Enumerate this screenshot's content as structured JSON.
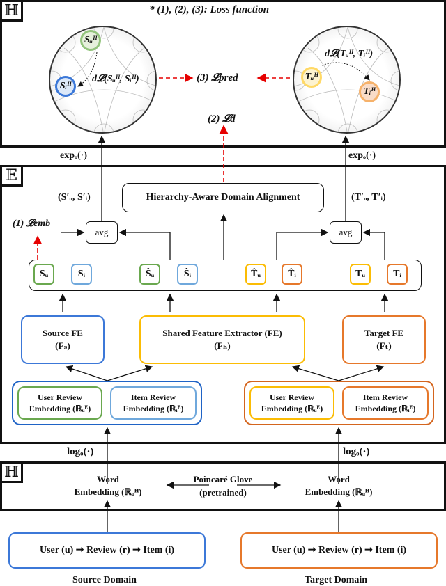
{
  "colors": {
    "green": "#6aa84f",
    "blue": "#3c78d8",
    "yellow": "#f1c232",
    "orange": "#e69138",
    "red_dashed": "#e60000",
    "green_fill": "#e6f0dc",
    "blue_fill": "#dce8f8",
    "yellow_fill": "#fdf3d0",
    "orange_fill": "#f9dcc8"
  },
  "top_panel": {
    "space_tag": "ℍ",
    "legend_note": "* (1), (2), (3): Loss function",
    "left_disk": {
      "node_u": "Sᵤᴴ",
      "node_i": "Sᵢᴴ",
      "distance": "d𝓛(Sᵤᴴ, Sᵢᴴ)"
    },
    "right_disk": {
      "node_u": "Tᵤᴴ",
      "node_i": "Tᵢᴴ",
      "distance": "d𝓛(Tᵤᴴ, Tᵢᴴ)"
    },
    "pred_loss": "(3) 𝓛pred",
    "domain_loss": "(2) 𝓛d"
  },
  "transitions": {
    "exp_left": "expₒ(·)",
    "exp_right": "expₒ(·)",
    "log_left": "logₒ(·)",
    "log_right": "logₒ(·)"
  },
  "middle_panel": {
    "space_tag": "𝔼",
    "alignment_box": "Hierarchy-Aware Domain Alignment",
    "source_pair": "(S′ᵤ, S′ᵢ)",
    "target_pair": "(T′ᵤ, T′ᵢ)",
    "emb_loss": "(1) 𝓛emb",
    "avg_left": "avg",
    "avg_right": "avg",
    "chips": [
      {
        "label": "Sᵤ",
        "color": "green"
      },
      {
        "label": "Sᵢ",
        "color": "blue"
      },
      {
        "label": "Ŝᵤ",
        "color": "green"
      },
      {
        "label": "Ŝᵢ",
        "color": "blue"
      },
      {
        "label": "T̂ᵤ",
        "color": "yellow"
      },
      {
        "label": "T̂ᵢ",
        "color": "orange"
      },
      {
        "label": "Tᵤ",
        "color": "yellow"
      },
      {
        "label": "Tᵢ",
        "color": "orange"
      }
    ],
    "source_fe": {
      "line1": "Source FE",
      "line2": "(Fₛ)"
    },
    "shared_fe": {
      "line1": "Shared Feature Extractor (FE)",
      "line2": "(Fₕ)"
    },
    "target_fe": {
      "line1": "Target FE",
      "line2": "(Fₜ)"
    },
    "source_embeddings": {
      "user": {
        "line1": "User Review",
        "line2": "Embedding (ℝᵤᴱ)"
      },
      "item": {
        "line1": "Item Review",
        "line2": "Embedding (ℝᵢᴱ)"
      }
    },
    "target_embeddings": {
      "user": {
        "line1": "User Review",
        "line2": "Embedding (ℝᵤᴱ)"
      },
      "item": {
        "line1": "Item Review",
        "line2": "Embedding (ℝᵢᴱ)"
      }
    }
  },
  "bottom_panel": {
    "space_tag": "ℍ",
    "word_left": {
      "line1": "Word",
      "line2": "Embedding (ℝᵤᴴ)"
    },
    "word_right": {
      "line1": "Word",
      "line2": "Embedding (ℝᵤᴴ)"
    },
    "glove": {
      "line1": "Poincaré Glove",
      "line2": "(pretrained)"
    }
  },
  "domains": {
    "source": {
      "flow": "User (u) ➞  Review (r)  ➞ Item (i)",
      "caption": "Source Domain"
    },
    "target": {
      "flow": "User (u) ➞  Review (r)  ➞ Item (i)",
      "caption": "Target Domain"
    }
  }
}
